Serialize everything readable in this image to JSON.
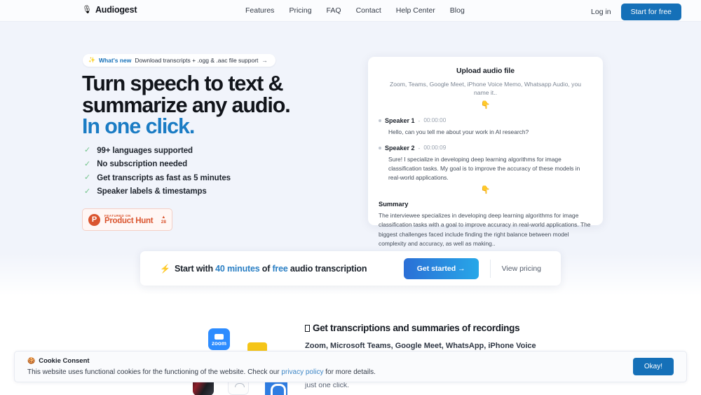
{
  "nav": {
    "brand": {
      "icon": "microphone-icon",
      "glyph": "🎙",
      "name": "Audiogest"
    },
    "links": [
      {
        "label": "Features"
      },
      {
        "label": "Pricing"
      },
      {
        "label": "FAQ"
      },
      {
        "label": "Contact"
      },
      {
        "label": "Help Center"
      },
      {
        "label": "Blog"
      }
    ],
    "login_label": "Log in",
    "cta_label": "Start for free"
  },
  "announcement": {
    "spark": "✨",
    "label": "What's new",
    "text": "Download transcripts + .ogg & .aac file support",
    "arrow": "→"
  },
  "hero": {
    "headline_line1": "Turn speech to text & summarize",
    "headline_line2": "any audio.",
    "headline_accent": "In one click.",
    "features": [
      {
        "check": "✓",
        "text": "99+ languages supported"
      },
      {
        "check": "✓",
        "text": "No subscription needed"
      },
      {
        "check": "✓",
        "text": "Get transcripts as fast as 5 minutes"
      },
      {
        "check": "✓",
        "text": "Speaker labels & timestamps"
      }
    ],
    "product_hunt": {
      "logo_letter": "P",
      "featured_on": "FEATURED ON",
      "name": "Product Hunt",
      "caret": "▲",
      "votes": "28"
    }
  },
  "transcript_card": {
    "title": "Upload audio file",
    "subtitle": "Zoom, Teams, Google Meet, iPhone Voice Memo, Whatsapp Audio, you name it..",
    "pointer": "👇",
    "entries": [
      {
        "speaker": "Speaker 1",
        "dash": "-",
        "time": "00:00:00",
        "text": "Hello, can you tell me about your work in AI research?"
      },
      {
        "speaker": "Speaker 2",
        "dash": "-",
        "time": "00:00:09",
        "text": "Sure! I specialize in developing deep learning algorithms for image classification tasks. My goal is to improve the accuracy of these models in real-world applications."
      }
    ],
    "summary_title": "Summary",
    "summary_text": "The interviewee specializes in developing deep learning algorithms for image classification tasks with a goal to improve accuracy in real-world applications. The biggest challenges faced include finding the right balance between model complexity and accuracy, as well as making.."
  },
  "cta_banner": {
    "bolt": "⚡",
    "text_before": "Start with ",
    "highlight1": "40 minutes",
    "text_middle": " of ",
    "highlight2": "free",
    "text_after": " audio transcription",
    "get_started_label": "Get started →",
    "view_pricing_label": "View pricing"
  },
  "lower_section": {
    "heading": "Get transcriptions and summaries of recordings",
    "paragraph_bold": "Zoom, Microsoft Teams, Google Meet, WhatsApp, iPhone Voice Memo,",
    "paragraph_rest": "Upload your audio or video file and get a transcript and summary with just one click.",
    "icons": [
      {
        "name": "zoom-app-icon",
        "label": "zoom"
      },
      {
        "name": "voice-memo-app-icon",
        "label": ""
      },
      {
        "name": "dark-app-icon",
        "label": ""
      },
      {
        "name": "white-app-icon",
        "label": ""
      },
      {
        "name": "teams-app-icon",
        "label": ""
      }
    ]
  },
  "cookie_banner": {
    "emoji": "🍪",
    "title": "Cookie Consent",
    "text_before": "This website uses functional cookies for the functioning of the website. Check our ",
    "link_label": "privacy policy",
    "text_after": " for more details.",
    "accept_label": "Okay!"
  },
  "colors": {
    "brand_blue": "#1570b8",
    "accent_blue": "#1b7cc4",
    "hero_bg": "#f1f4fb",
    "product_hunt": "#da552f",
    "check_green": "#72c48a"
  }
}
